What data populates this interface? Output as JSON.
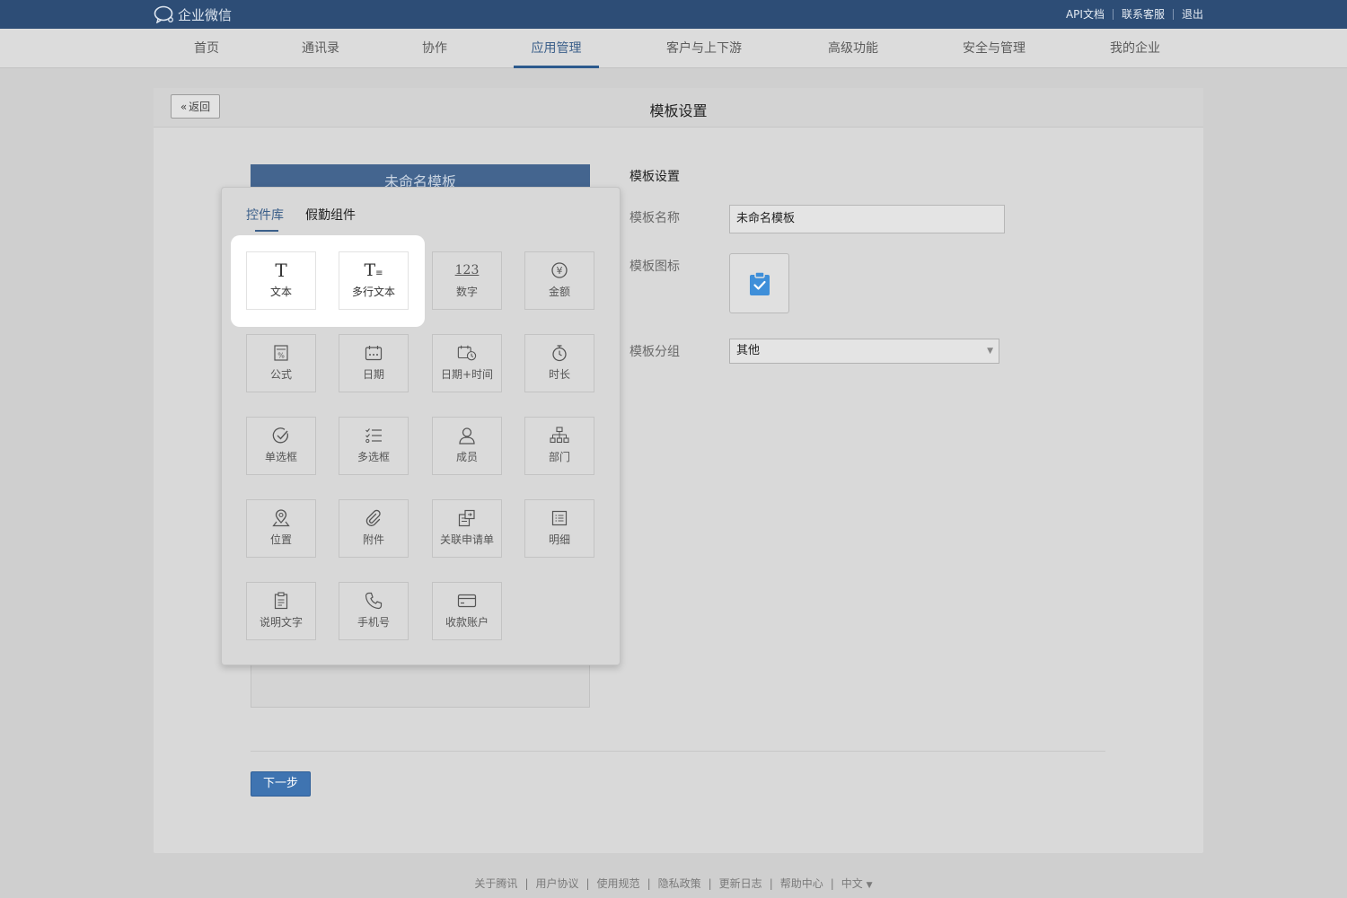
{
  "app": {
    "name": "企业微信"
  },
  "top_links": [
    "API文档",
    "联系客服",
    "退出"
  ],
  "nav": [
    {
      "label": "首页",
      "active": false
    },
    {
      "label": "通讯录",
      "active": false
    },
    {
      "label": "协作",
      "active": false
    },
    {
      "label": "应用管理",
      "active": true
    },
    {
      "label": "客户与上下游",
      "active": false
    },
    {
      "label": "高级功能",
      "active": false
    },
    {
      "label": "安全与管理",
      "active": false
    },
    {
      "label": "我的企业",
      "active": false
    }
  ],
  "page": {
    "title": "模板设置",
    "back_label": "返回"
  },
  "preview": {
    "title": "未命名模板"
  },
  "settings": {
    "section_title": "模板设置",
    "name_label": "模板名称",
    "name_value": "未命名模板",
    "icon_label": "模板图标",
    "icon_name": "clipboard-check-icon",
    "group_label": "模板分组",
    "group_value": "其他",
    "next_label": "下一步"
  },
  "popup": {
    "tabs": [
      {
        "label": "控件库",
        "active": true
      },
      {
        "label": "假勤组件",
        "active": false
      }
    ],
    "components": [
      {
        "label": "文本",
        "icon": "text-icon",
        "highlighted": true
      },
      {
        "label": "多行文本",
        "icon": "multiline-text-icon",
        "highlighted": true
      },
      {
        "label": "数字",
        "icon": "number-icon",
        "highlighted": false
      },
      {
        "label": "金额",
        "icon": "currency-icon",
        "highlighted": false
      },
      {
        "label": "公式",
        "icon": "formula-icon",
        "highlighted": false
      },
      {
        "label": "日期",
        "icon": "calendar-icon",
        "highlighted": false
      },
      {
        "label": "日期+时间",
        "icon": "calendar-clock-icon",
        "highlighted": false
      },
      {
        "label": "时长",
        "icon": "stopwatch-icon",
        "highlighted": false
      },
      {
        "label": "单选框",
        "icon": "radio-check-icon",
        "highlighted": false
      },
      {
        "label": "多选框",
        "icon": "checklist-icon",
        "highlighted": false
      },
      {
        "label": "成员",
        "icon": "person-icon",
        "highlighted": false
      },
      {
        "label": "部门",
        "icon": "org-chart-icon",
        "highlighted": false
      },
      {
        "label": "位置",
        "icon": "location-icon",
        "highlighted": false
      },
      {
        "label": "附件",
        "icon": "paperclip-icon",
        "highlighted": false
      },
      {
        "label": "关联申请单",
        "icon": "linked-form-icon",
        "highlighted": false
      },
      {
        "label": "明细",
        "icon": "detail-list-icon",
        "highlighted": false
      },
      {
        "label": "说明文字",
        "icon": "note-icon",
        "highlighted": false
      },
      {
        "label": "手机号",
        "icon": "phone-icon",
        "highlighted": false
      },
      {
        "label": "收款账户",
        "icon": "card-icon",
        "highlighted": false
      }
    ]
  },
  "footer": [
    "关于腾讯",
    "用户协议",
    "使用规范",
    "隐私政策",
    "更新日志",
    "帮助中心",
    "中文"
  ]
}
